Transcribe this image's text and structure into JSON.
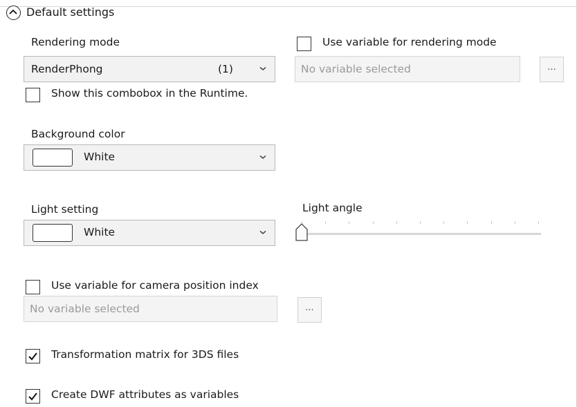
{
  "section": {
    "title": "Default settings"
  },
  "rendering": {
    "label": "Rendering mode",
    "selected": "RenderPhong",
    "count": "(1)",
    "use_variable_label": "Use variable for rendering mode",
    "use_variable_checked": false,
    "variable_placeholder": "No variable selected",
    "browse_label": "...",
    "show_in_runtime_label": "Show this combobox in the Runtime.",
    "show_in_runtime_checked": false
  },
  "background": {
    "label": "Background color",
    "selected": "White",
    "swatch_color": "#ffffff"
  },
  "light": {
    "label": "Light setting",
    "selected": "White",
    "swatch_color": "#ffffff",
    "angle_label": "Light angle",
    "angle_value_fraction": 0.0
  },
  "camera": {
    "use_variable_label": "Use variable for camera position index",
    "use_variable_checked": false,
    "variable_placeholder": "No variable selected",
    "browse_label": "..."
  },
  "transformation": {
    "label": "Transformation matrix for 3DS files",
    "checked": true
  },
  "dwf": {
    "label": "Create DWF attributes as variables",
    "checked": true
  }
}
